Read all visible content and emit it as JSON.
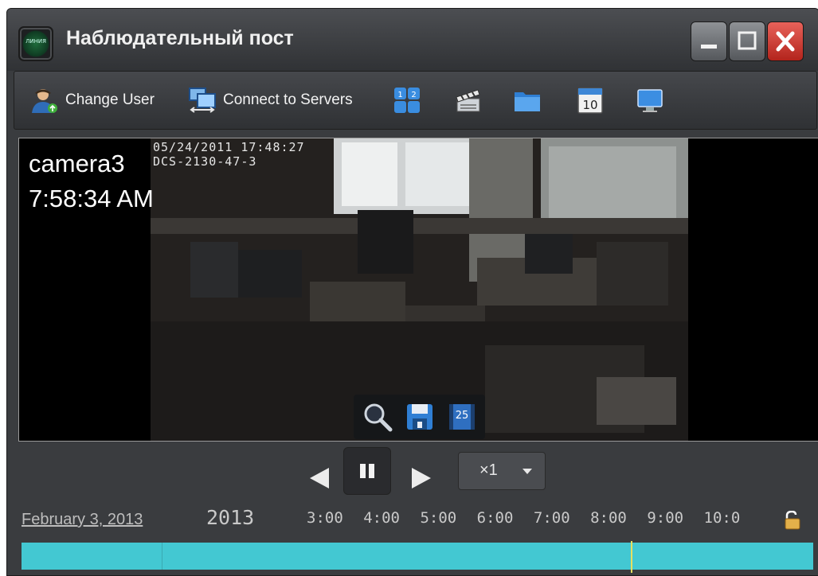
{
  "window": {
    "title": "Наблюдательный пост",
    "logo_text": "ЛИНИЯ",
    "buttons": [
      "minimize",
      "maximize",
      "close"
    ]
  },
  "toolbar": {
    "items": [
      {
        "label": "Change User",
        "icon": "user-icon"
      },
      {
        "label": "Connect to Servers",
        "icon": "servers-icon"
      },
      {
        "label": "",
        "icon": "layout-grid-icon"
      },
      {
        "label": "",
        "icon": "clapperboard-icon"
      },
      {
        "label": "",
        "icon": "folder-icon"
      },
      {
        "label": "",
        "icon": "calendar-icon",
        "calendar_day": "10"
      },
      {
        "label": "",
        "icon": "monitor-icon"
      }
    ]
  },
  "video": {
    "camera_name": "camera3",
    "time": "7:58:34 AM",
    "osd_datetime": "05/24/2011 17:48:27",
    "osd_device": "DCS-2130-47-3",
    "tools": [
      {
        "icon": "zoom-icon"
      },
      {
        "icon": "save-icon"
      },
      {
        "icon": "fps-icon",
        "text": "25"
      }
    ]
  },
  "playback": {
    "speed": "×1",
    "date": "February 3, 2013",
    "year": "2013",
    "ticks": [
      "3:00",
      "4:00",
      "5:00",
      "6:00",
      "7:00",
      "8:00",
      "9:00",
      "10:0"
    ],
    "cursor_time": "7:58:34",
    "colors": {
      "timeline": "#43c8d2",
      "cursor": "#e6e060"
    }
  }
}
